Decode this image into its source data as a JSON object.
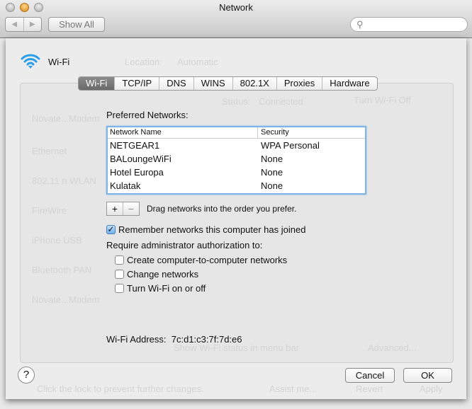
{
  "window": {
    "title": "Network",
    "show_all": "Show All",
    "search_placeholder": "",
    "back": "◀",
    "forward": "▶"
  },
  "background": {
    "location_label": "Location:",
    "location_value": "Automatic",
    "status_label": "Status:",
    "status_value": "Connected",
    "turn_off": "Turn Wi-Fi Off",
    "services": [
      "Novate...Modem",
      "Ethernet",
      "802.11 n WLAN",
      "FireWire",
      "iPhone USB",
      "Bluetooth PAN",
      "Novate...Modem"
    ],
    "show_status": "Show Wi-Fi status in menu bar",
    "advanced": "Advanced...",
    "lock_text": "Click the lock to prevent further changes.",
    "assist": "Assist me...",
    "revert": "Revert",
    "apply": "Apply"
  },
  "header": {
    "service": "Wi-Fi"
  },
  "tabs": [
    "Wi-Fi",
    "TCP/IP",
    "DNS",
    "WINS",
    "802.1X",
    "Proxies",
    "Hardware"
  ],
  "preferred": {
    "label": "Preferred Networks:",
    "columns": [
      "Network Name",
      "Security"
    ],
    "rows": [
      [
        "NETGEAR1",
        "WPA Personal"
      ],
      [
        "BALoungeWiFi",
        "None"
      ],
      [
        "Hotel Europa",
        "None"
      ],
      [
        "Kulatak",
        "None"
      ]
    ],
    "add": "+",
    "remove": "−",
    "hint": "Drag networks into the order you prefer."
  },
  "options": {
    "remember": {
      "label": "Remember networks this computer has joined",
      "checked": true
    },
    "require_label": "Require administrator authorization to:",
    "items": [
      {
        "label": "Create computer-to-computer networks",
        "checked": false
      },
      {
        "label": "Change networks",
        "checked": false
      },
      {
        "label": "Turn Wi-Fi on or off",
        "checked": false
      }
    ]
  },
  "address": {
    "label": "Wi-Fi Address:",
    "value": "7c:d1:c3:7f:7d:e6"
  },
  "buttons": {
    "help": "?",
    "cancel": "Cancel",
    "ok": "OK"
  }
}
